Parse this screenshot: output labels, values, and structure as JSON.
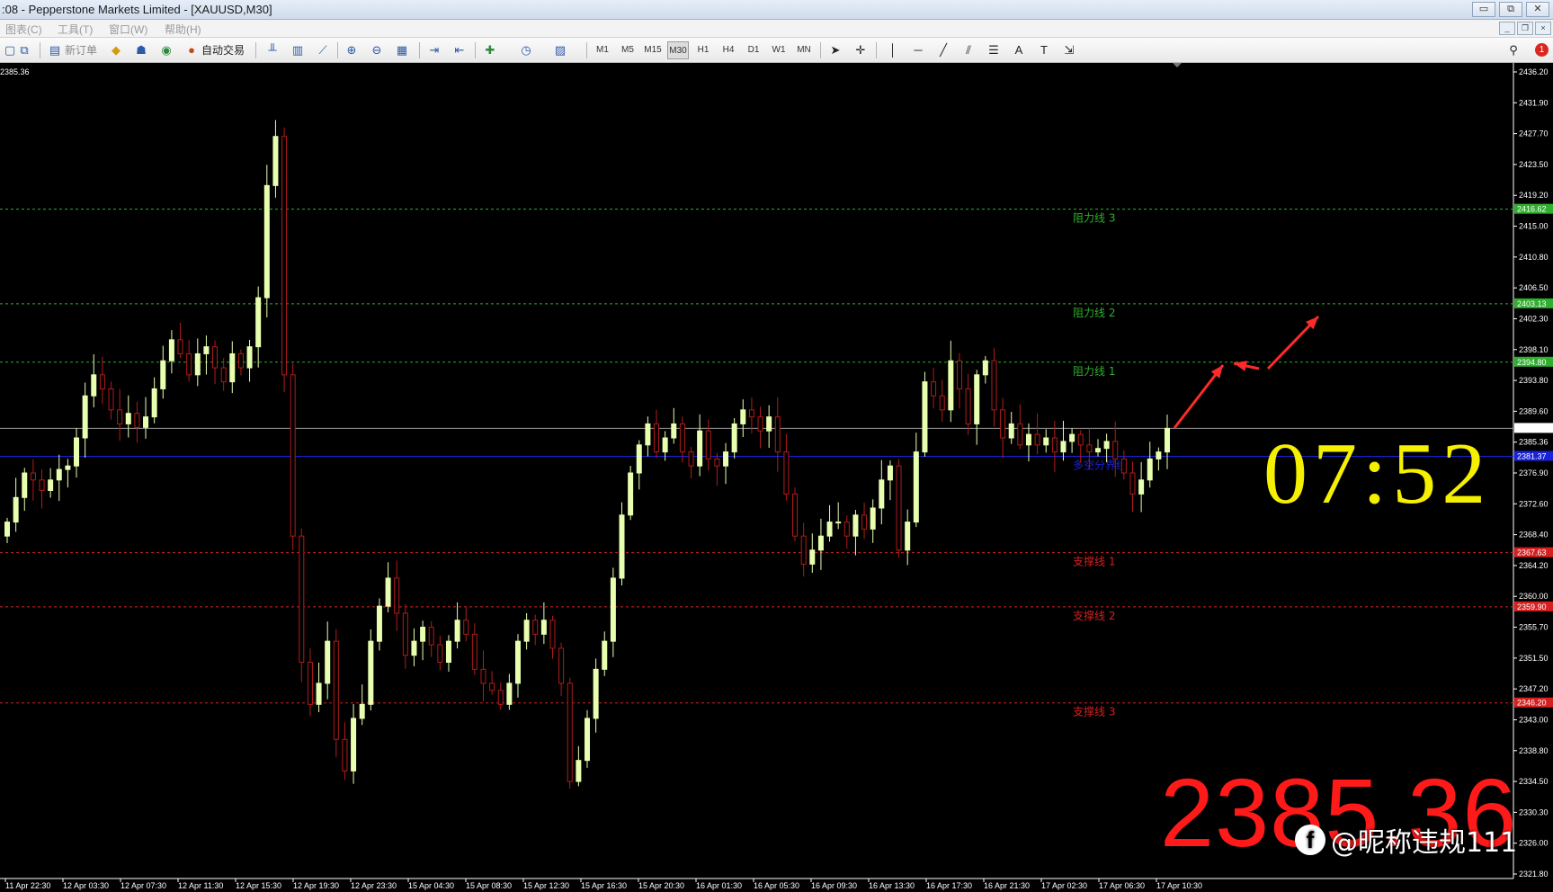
{
  "window": {
    "title": ":08 - Pepperstone Markets Limited - [XAUUSD,M30]",
    "controls": [
      "▭",
      "⧉",
      "✕"
    ]
  },
  "menu": {
    "items": [
      "图表(C)",
      "工具(T)",
      "窗口(W)",
      "帮助(H)"
    ],
    "mdi_controls": [
      "_",
      "❐",
      "×"
    ]
  },
  "toolbar": {
    "new_order": "新订单",
    "auto_trade": "自动交易",
    "timeframes": [
      "M1",
      "M5",
      "M15",
      "M30",
      "H1",
      "H4",
      "D1",
      "W1",
      "MN"
    ],
    "active_timeframe": "M30",
    "notification_count": "1"
  },
  "chart": {
    "top_left_price": "2385.36",
    "current_price_tag": "2385.36",
    "price_axis": [
      "2436.20",
      "2431.90",
      "2427.70",
      "2423.50",
      "2419.20",
      "2415.00",
      "2410.80",
      "2406.50",
      "2402.30",
      "2398.10",
      "2393.80",
      "2389.60",
      "2385.36",
      "2376.90",
      "2372.60",
      "2368.40",
      "2364.20",
      "2360.00",
      "2355.70",
      "2351.50",
      "2347.20",
      "2343.00",
      "2338.80",
      "2334.50",
      "2330.30",
      "2326.00",
      "2321.80"
    ],
    "level_tags": {
      "r3": "2416.62",
      "r2": "2403.13",
      "r1": "2394.80",
      "pivot": "2381.37",
      "s1": "2367.63",
      "s2": "2359.90",
      "s3": "2346.20"
    },
    "level_labels": {
      "r3": "阻力线 3",
      "r2": "阻力线 2",
      "r1": "阻力线 1",
      "pivot": "多空分界线",
      "s1": "支撑线 1",
      "s2": "支撑线 2",
      "s3": "支撑线 3"
    },
    "time_axis": [
      "11 Apr 22:30",
      "12 Apr 03:30",
      "12 Apr 07:30",
      "12 Apr 11:30",
      "12 Apr 15:30",
      "12 Apr 19:30",
      "12 Apr 23:30",
      "15 Apr 04:30",
      "15 Apr 08:30",
      "15 Apr 12:30",
      "15 Apr 16:30",
      "15 Apr 20:30",
      "16 Apr 01:30",
      "16 Apr 05:30",
      "16 Apr 09:30",
      "16 Apr 13:30",
      "16 Apr 17:30",
      "16 Apr 21:30",
      "17 Apr 02:30",
      "17 Apr 06:30",
      "17 Apr 10:30"
    ],
    "colors": {
      "bull": "#e8ffb0",
      "bear": "#b11b1b",
      "resistance": "#2fae2f",
      "support": "#d42020",
      "pivot": "#1a22d8",
      "arrow": "#ff2a2a"
    }
  },
  "overlay": {
    "countdown": "07:52",
    "big_price": "2385.36",
    "watermark": "@昵称违规111",
    "watermark_logo": "f"
  },
  "chart_data": {
    "type": "candlestick",
    "symbol": "XAUUSD",
    "timeframe": "M30",
    "ylim": [
      2321.8,
      2436.2
    ],
    "closes": [
      2372.0,
      2375.5,
      2379.0,
      2378.0,
      2376.5,
      2378.0,
      2379.5,
      2380.0,
      2384.0,
      2390.0,
      2393.0,
      2391.0,
      2388.0,
      2386.0,
      2387.5,
      2385.5,
      2387.0,
      2391.0,
      2395.0,
      2398.0,
      2396.0,
      2393.0,
      2396.0,
      2397.0,
      2394.0,
      2392.0,
      2396.0,
      2394.0,
      2397.0,
      2404.0,
      2420.0,
      2427.0,
      2393.0,
      2370.0,
      2352.0,
      2346.0,
      2349.0,
      2355.0,
      2341.0,
      2336.5,
      2344.0,
      2346.0,
      2355.0,
      2360.0,
      2364.0,
      2359.0,
      2353.0,
      2355.0,
      2357.0,
      2354.5,
      2352.0,
      2355.0,
      2358.0,
      2356.0,
      2351.0,
      2349.0,
      2348.0,
      2346.0,
      2349.0,
      2355.0,
      2358.0,
      2356.0,
      2358.0,
      2354.0,
      2349.0,
      2335.0,
      2338.0,
      2344.0,
      2351.0,
      2355.0,
      2364.0,
      2373.0,
      2379.0,
      2383.0,
      2386.0,
      2382.0,
      2384.0,
      2386.0,
      2382.0,
      2380.0,
      2385.0,
      2381.0,
      2380.0,
      2382.0,
      2386.0,
      2388.0,
      2387.0,
      2385.0,
      2387.0,
      2382.0,
      2376.0,
      2370.0,
      2366.0,
      2368.0,
      2370.0,
      2372.0,
      2372.0,
      2370.0,
      2373.0,
      2371.0,
      2374.0,
      2378.0,
      2380.0,
      2368.0,
      2372.0,
      2382.0,
      2392.0,
      2390.0,
      2388.0,
      2395.0,
      2391.0,
      2386.0,
      2393.0,
      2395.0,
      2388.0,
      2384.0,
      2386.0,
      2383.0,
      2384.5,
      2383.0,
      2384.0,
      2382.0,
      2383.5,
      2384.5,
      2383.0,
      2382.0,
      2382.5,
      2383.5,
      2381.0,
      2379.0,
      2376.0,
      2378.0,
      2381.0,
      2382.0,
      2385.36
    ],
    "levels": [
      {
        "label": "阻力线 3",
        "price": 2416.62,
        "kind": "resistance"
      },
      {
        "label": "阻力线 2",
        "price": 2403.13,
        "kind": "resistance"
      },
      {
        "label": "阻力线 1",
        "price": 2394.8,
        "kind": "resistance"
      },
      {
        "label": "多空分界线",
        "price": 2381.37,
        "kind": "pivot"
      },
      {
        "label": "支撑线 1",
        "price": 2367.63,
        "kind": "support"
      },
      {
        "label": "支撑线 2",
        "price": 2359.9,
        "kind": "support"
      },
      {
        "label": "支撑线 3",
        "price": 2346.2,
        "kind": "support"
      }
    ],
    "current_price": 2385.36
  }
}
